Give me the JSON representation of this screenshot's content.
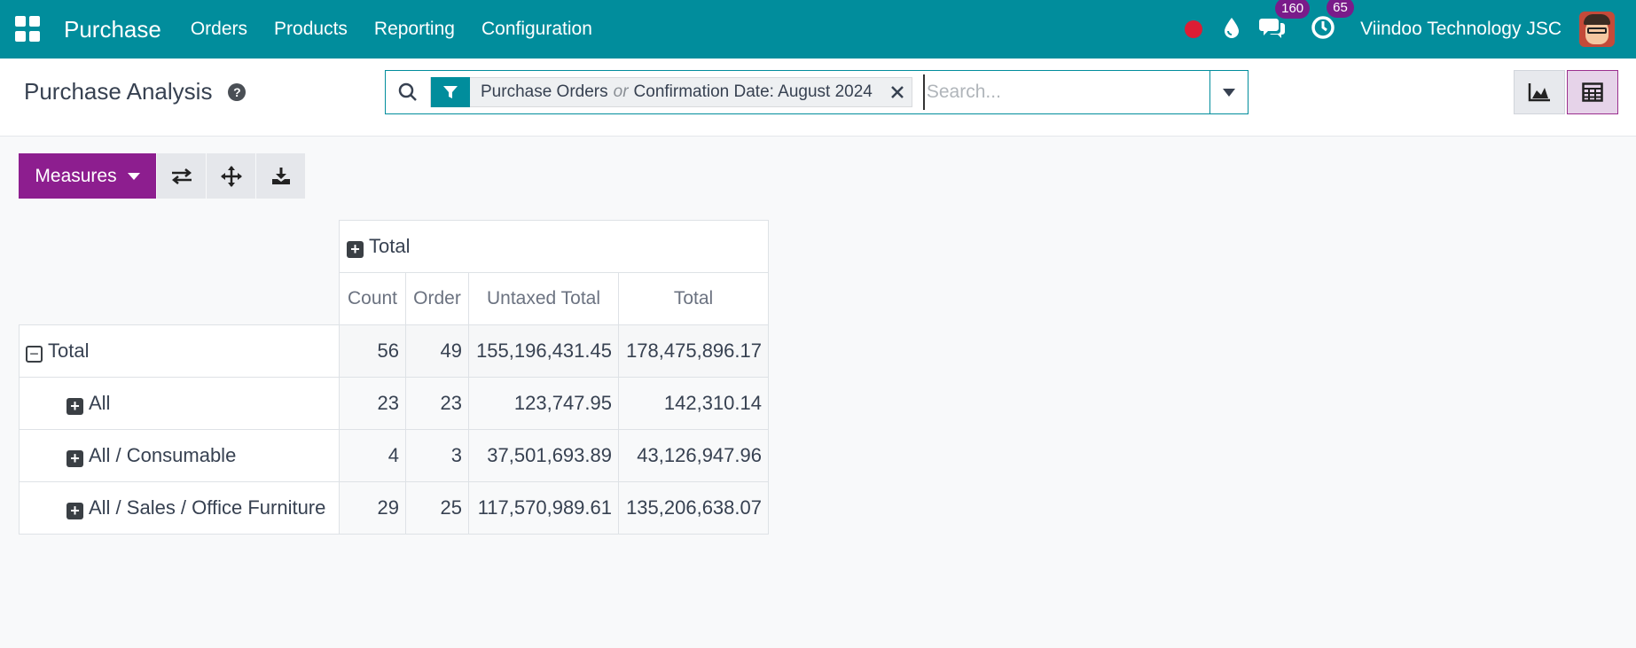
{
  "navbar": {
    "brand": "Purchase",
    "menu": [
      "Orders",
      "Products",
      "Reporting",
      "Configuration"
    ],
    "messages_badge": "160",
    "activities_badge": "65",
    "company": "Viindoo Technology JSC",
    "colors": {
      "bar": "#018d9c",
      "badge": "#7a1b8a",
      "record": "#dc1d34"
    }
  },
  "control_panel": {
    "title": "Purchase Analysis",
    "facet": {
      "part1": "Purchase Orders",
      "separator": "or",
      "part2": "Confirmation Date: August 2024"
    },
    "search_placeholder": "Search...",
    "views": [
      "graph-view-icon",
      "pivot-view-icon"
    ],
    "active_view": "pivot"
  },
  "toolbar": {
    "measures_label": "Measures",
    "accent": "#8d1e8f"
  },
  "pivot": {
    "column_group": "Total",
    "measures": [
      "Count",
      "Order",
      "Untaxed Total",
      "Total"
    ],
    "rows": [
      {
        "label": "Total",
        "count": "56",
        "order": "49",
        "untaxed": "155,196,431.45",
        "total": "178,475,896.17"
      },
      {
        "label": "All",
        "count": "23",
        "order": "23",
        "untaxed": "123,747.95",
        "total": "142,310.14"
      },
      {
        "label": "All / Consumable",
        "count": "4",
        "order": "3",
        "untaxed": "37,501,693.89",
        "total": "43,126,947.96"
      },
      {
        "label": "All / Sales / Office Furniture",
        "count": "29",
        "order": "25",
        "untaxed": "117,570,989.61",
        "total": "135,206,638.07"
      }
    ]
  }
}
